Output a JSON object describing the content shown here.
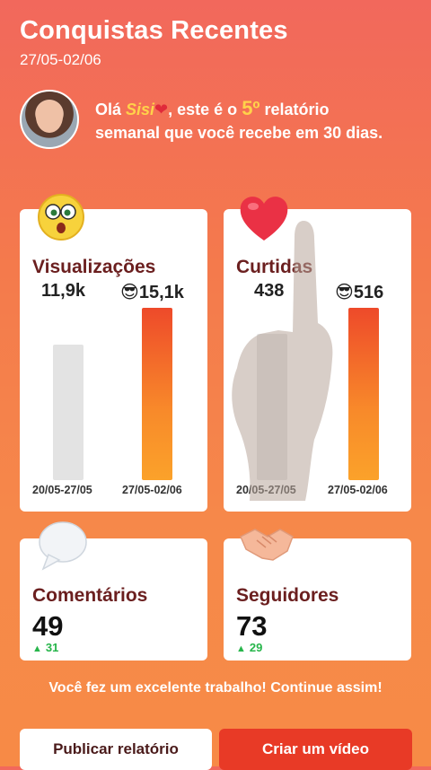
{
  "header": {
    "title": "Conquistas Recentes",
    "dates": "27/05-02/06"
  },
  "greeting": {
    "prefix": "Olá ",
    "name": "Sisi",
    "middle": ", este é o ",
    "number": "5º",
    "suffix": " relatório semanal que você recebe em 30 dias."
  },
  "views": {
    "title": "Visualizações",
    "prev_value": "11,9k",
    "curr_value": "15,1k",
    "prev_range": "20/05-27/05",
    "curr_range": "27/05-02/06",
    "prev_ratio": 0.788,
    "curr_ratio": 1.0
  },
  "likes": {
    "title": "Curtidas",
    "prev_value": "438",
    "curr_value": "516",
    "prev_range": "20/05-27/05",
    "curr_range": "27/05-02/06",
    "prev_ratio": 0.849,
    "curr_ratio": 1.0
  },
  "comments": {
    "title": "Comentários",
    "value": "49",
    "delta": "31"
  },
  "followers": {
    "title": "Seguidores",
    "value": "73",
    "delta": "29"
  },
  "footer": {
    "message": "Você fez um excelente trabalho! Continue assim!",
    "publish_label": "Publicar relatório",
    "create_label": "Criar um vídeo"
  },
  "colors": {
    "accent_red": "#e83a26",
    "gold": "#ffd24a",
    "up_green": "#26b54a"
  }
}
